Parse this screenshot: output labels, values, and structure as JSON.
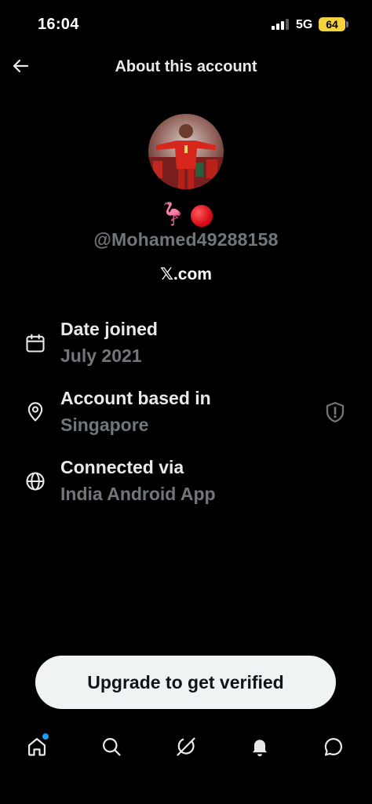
{
  "status_bar": {
    "time": "16:04",
    "network": "5G",
    "battery": "64",
    "battery_color": "#f4d13d"
  },
  "header": {
    "title": "About this account",
    "back_icon": "arrow-left-icon"
  },
  "profile": {
    "avatar_description_icon": "avatar",
    "emoji": "🦩",
    "handle": "@Mohamed49288158",
    "site": "𝕏.com"
  },
  "info": [
    {
      "icon": "calendar-icon",
      "label": "Date joined",
      "value": "July 2021"
    },
    {
      "icon": "location-pin-icon",
      "label": "Account based in",
      "value": "Singapore"
    },
    {
      "icon": "globe-icon",
      "label": "Connected via",
      "value": "India Android App"
    }
  ],
  "upgrade_button": {
    "label": "Upgrade to get verified"
  },
  "nav": [
    {
      "icon": "home-icon"
    },
    {
      "icon": "search-icon"
    },
    {
      "icon": "grok-icon"
    },
    {
      "icon": "bell-icon"
    },
    {
      "icon": "messages-icon"
    }
  ],
  "colors": {
    "background": "#000000",
    "primary_text": "#e7e9ea",
    "secondary_text": "#71767b",
    "accent": "#1d9bf0",
    "button_bg": "#eff3f4"
  }
}
